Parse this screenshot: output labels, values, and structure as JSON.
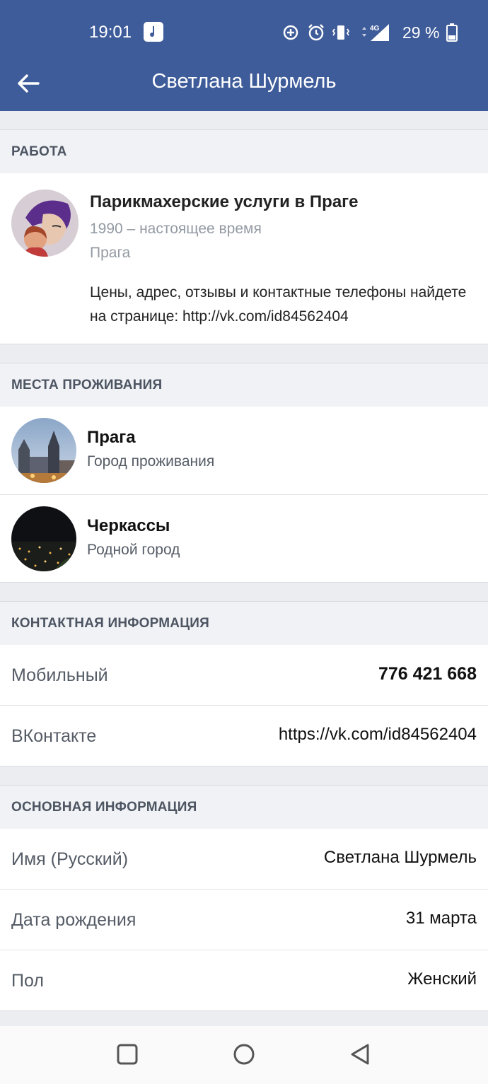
{
  "status_bar": {
    "time": "19:01",
    "battery_percent": "29 %",
    "network": "4G"
  },
  "app_bar": {
    "title": "Светлана Шурмель"
  },
  "work": {
    "header": "РАБОТА",
    "title": "Парикмахерские услуги в Праге",
    "period": "1990 – настоящее время",
    "city": "Прага",
    "description": "Цены, адрес, отзывы и контактные телефоны найдете на странице: http://vk.com/id84562404"
  },
  "places": {
    "header": "МЕСТА ПРОЖИВАНИЯ",
    "items": [
      {
        "name": "Прага",
        "subtitle": "Город проживания"
      },
      {
        "name": "Черкассы",
        "subtitle": "Родной город"
      }
    ]
  },
  "contacts": {
    "header": "КОНТАКТНАЯ ИНФОРМАЦИЯ",
    "rows": [
      {
        "label": "Мобильный",
        "value": "776 421 668"
      },
      {
        "label": "ВКонтакте",
        "value": "https://vk.com/id84562404"
      }
    ]
  },
  "basic": {
    "header": "ОСНОВНАЯ ИНФОРМАЦИЯ",
    "rows": [
      {
        "label": "Имя (Русский)",
        "value": "Светлана Шурмель"
      },
      {
        "label": "Дата рождения",
        "value": "31 марта"
      },
      {
        "label": "Пол",
        "value": "Женский"
      }
    ]
  },
  "colors": {
    "header_bg": "#3e5b9a",
    "section_bg": "#ebedf0",
    "muted_text": "#939aa3"
  }
}
